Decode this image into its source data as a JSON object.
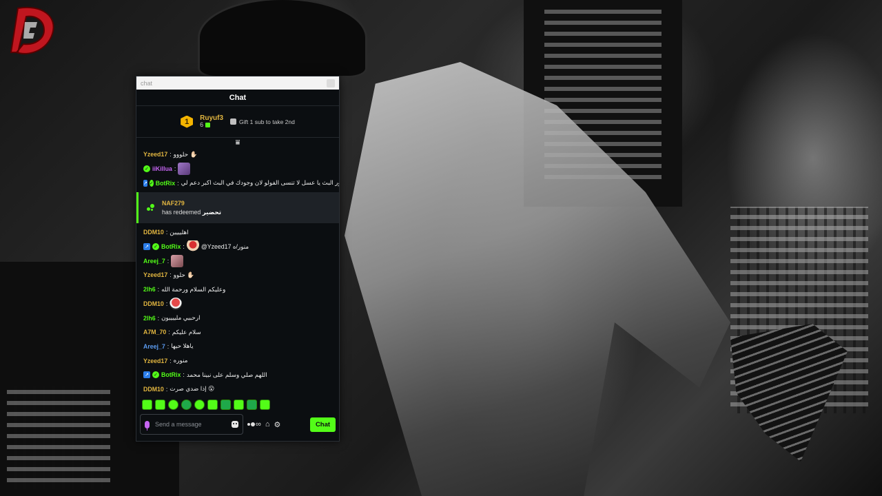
{
  "window": {
    "title": "chat"
  },
  "chat": {
    "header": "Chat",
    "leaderboard": {
      "rank": "1",
      "username": "Ruyuf3",
      "count": "6",
      "gift_text": "Gift 1 sub to take 2nd"
    },
    "messages": [
      {
        "user": "Yzeed17",
        "color": "#e2b640",
        "text": "حلووو ✋🏻",
        "badges": []
      },
      {
        "user": "iiKillua",
        "color": "#c565f2",
        "text": "",
        "badges": [
          "check"
        ],
        "emote": "purple"
      },
      {
        "user": "BotRix",
        "color": "#53fc18",
        "text": "منور البث يا عسل لا تنسى الفولو لان وجودك في البث اكبر دعم لي",
        "badges": [
          "arrow",
          "check"
        ]
      },
      {
        "type": "redeem",
        "user": "NAF279",
        "line": "has redeemed",
        "reward": "تحضير"
      },
      {
        "user": "DDM10",
        "color": "#e2b640",
        "text": "اهليييين",
        "badges": []
      },
      {
        "user": "BotRix",
        "color": "#53fc18",
        "text": "@Yzeed17 منور/ه",
        "badges": [
          "arrow",
          "check"
        ],
        "emote": "mario"
      },
      {
        "user": "Areej_7",
        "color": "#53fc18",
        "text": "",
        "badges": [],
        "emote": "pink"
      },
      {
        "user": "Yzeed17",
        "color": "#e2b640",
        "text": "حلوو ✋🏻",
        "badges": []
      },
      {
        "user": "2lh6",
        "color": "#53fc18",
        "text": "وعليكم السلام ورحمة الله",
        "badges": []
      },
      {
        "user": "DDM10",
        "color": "#e2b640",
        "text": "",
        "badges": [],
        "emote": "red"
      },
      {
        "user": "2lh6",
        "color": "#53fc18",
        "text": "ارحبيي ملييييون",
        "badges": []
      },
      {
        "user": "A7M_70",
        "color": "#e2b640",
        "text": "سلام عليكم",
        "badges": []
      },
      {
        "user": "Areej_7",
        "color": "#5b9bf0",
        "text": "ياهلا حيها",
        "badges": []
      },
      {
        "user": "Yzeed17",
        "color": "#e2b640",
        "text": "منوره",
        "badges": []
      },
      {
        "user": "BotRix",
        "color": "#53fc18",
        "text": "اللهم صلي وسلم على نبينا محمد",
        "badges": [
          "arrow",
          "check"
        ]
      },
      {
        "user": "DDM10",
        "color": "#e2b640",
        "text": "إذا ضدي صرت 😮",
        "badges": []
      }
    ],
    "input": {
      "placeholder": "Send a message"
    },
    "send_label": "Chat"
  },
  "colors": {
    "accent": "#53fc18",
    "panel_bg": "#0b0e11",
    "redeem_bg": "#1e2227"
  }
}
